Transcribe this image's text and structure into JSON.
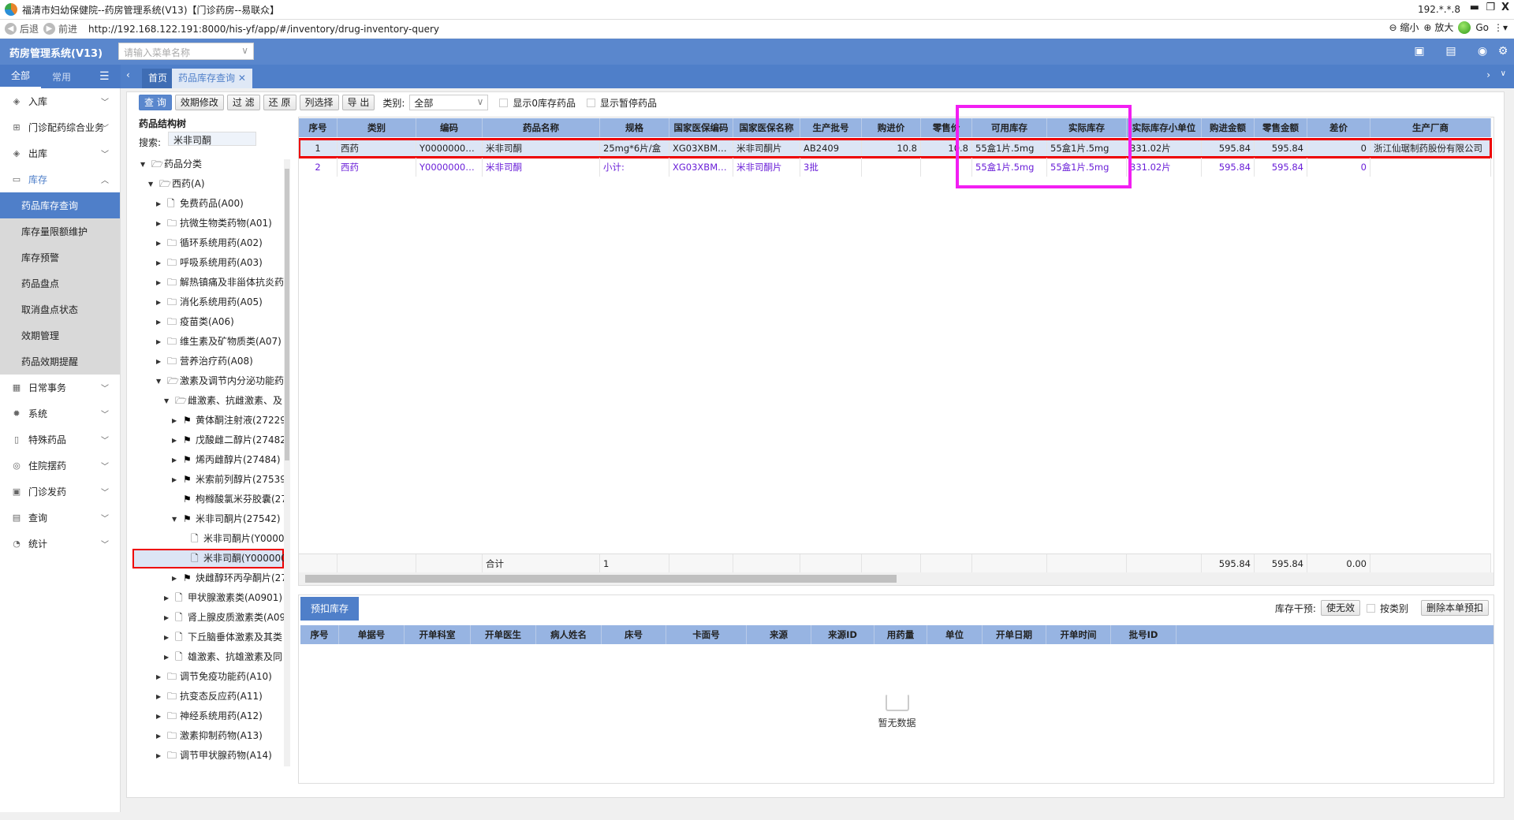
{
  "window": {
    "title": "福清市妇幼保健院--药房管理系统(V13)【门诊药房--易联众】",
    "ip": "192.*.*.8",
    "min": "▬",
    "restore": "❐",
    "close": "X"
  },
  "browser": {
    "back": "后退",
    "forward": "前进",
    "url": "http://192.168.122.191:8000/his-yf/app/#/inventory/drug-inventory-query",
    "zoom_out": "缩小",
    "zoom_in": "放大",
    "go": "Go"
  },
  "app": {
    "title": "药房管理系统(V13)",
    "menu_search_placeholder": "请输入菜单名称"
  },
  "sidetabs": [
    "全部",
    "常用"
  ],
  "tabs": [
    {
      "label": "首页"
    },
    {
      "label": "药品库存查询"
    }
  ],
  "sidebar": [
    {
      "label": "入库",
      "icon": "box-icon",
      "type": "group"
    },
    {
      "label": "门诊配药综合业务",
      "icon": "medkit-icon",
      "type": "group"
    },
    {
      "label": "出库",
      "icon": "box-out-icon",
      "type": "group"
    },
    {
      "label": "库存",
      "icon": "inventory-icon",
      "type": "open"
    },
    {
      "label": "药品库存查询",
      "type": "sel"
    },
    {
      "label": "库存量限额维护",
      "type": "sub"
    },
    {
      "label": "库存预警",
      "type": "sub"
    },
    {
      "label": "药品盘点",
      "type": "sub"
    },
    {
      "label": "取消盘点状态",
      "type": "sub"
    },
    {
      "label": "效期管理",
      "type": "sub"
    },
    {
      "label": "药品效期提醒",
      "type": "sub"
    },
    {
      "label": "日常事务",
      "icon": "calendar-icon",
      "type": "group"
    },
    {
      "label": "系统",
      "icon": "gear-icon",
      "type": "group"
    },
    {
      "label": "特殊药品",
      "icon": "bottle-icon",
      "type": "group"
    },
    {
      "label": "住院摆药",
      "icon": "pill-icon",
      "type": "group"
    },
    {
      "label": "门诊发药",
      "icon": "dispense-icon",
      "type": "group"
    },
    {
      "label": "查询",
      "icon": "query-icon",
      "type": "group"
    },
    {
      "label": "统计",
      "icon": "stats-icon",
      "type": "group"
    }
  ],
  "toolbar": {
    "query": "查 询",
    "expiry_edit": "效期修改",
    "filter": "过 滤",
    "reset": "还 原",
    "columns": "列选择",
    "export": "导 出",
    "category_label": "类别:",
    "category_value": "全部",
    "show_zero": "显示0库存药品",
    "show_paused": "显示暂停药品"
  },
  "tree": {
    "title": "药品结构树",
    "search_label": "搜索:",
    "search_value": "米非司酮",
    "items": [
      {
        "l": 0,
        "t": "药品分类",
        "i": "open",
        "a": "down"
      },
      {
        "l": 1,
        "t": "西药(A)",
        "i": "open",
        "a": "down"
      },
      {
        "l": 2,
        "t": "免费药品(A00)",
        "i": "file",
        "a": "right"
      },
      {
        "l": 2,
        "t": "抗微生物类药物(A01)",
        "i": "folder",
        "a": "right"
      },
      {
        "l": 2,
        "t": "循环系统用药(A02)",
        "i": "folder",
        "a": "right"
      },
      {
        "l": 2,
        "t": "呼吸系统用药(A03)",
        "i": "folder",
        "a": "right"
      },
      {
        "l": 2,
        "t": "解热镇痛及非甾体抗炎药",
        "i": "folder",
        "a": "right"
      },
      {
        "l": 2,
        "t": "消化系统用药(A05)",
        "i": "folder",
        "a": "right"
      },
      {
        "l": 2,
        "t": "疫苗类(A06)",
        "i": "folder",
        "a": "right"
      },
      {
        "l": 2,
        "t": "维生素及矿物质类(A07)",
        "i": "folder",
        "a": "right"
      },
      {
        "l": 2,
        "t": "营养治疗药(A08)",
        "i": "folder",
        "a": "right"
      },
      {
        "l": 2,
        "t": "激素及调节内分泌功能药",
        "i": "open",
        "a": "down"
      },
      {
        "l": 3,
        "t": "雌激素、抗雌激素、及",
        "i": "open",
        "a": "down"
      },
      {
        "l": 4,
        "t": "黄体酮注射液(27229)",
        "i": "flag",
        "a": "right"
      },
      {
        "l": 4,
        "t": "戊酸雌二醇片(27482)",
        "i": "flag",
        "a": "right"
      },
      {
        "l": 4,
        "t": "烯丙雌醇片(27484)",
        "i": "flag",
        "a": "right"
      },
      {
        "l": 4,
        "t": "米索前列醇片(27539)",
        "i": "flag",
        "a": "right"
      },
      {
        "l": 4,
        "t": "枸橼酸氯米芬胶囊(27",
        "i": "flag",
        "a": ""
      },
      {
        "l": 4,
        "t": "米非司酮片(27542)",
        "i": "flag",
        "a": "down"
      },
      {
        "l": 5,
        "t": "米非司酮片(Y00000...",
        "i": "file",
        "a": ""
      },
      {
        "l": 5,
        "t": "米非司酮(Y0000000",
        "i": "file",
        "a": "",
        "sel": true
      },
      {
        "l": 4,
        "t": "炔雌醇环丙孕酮片(27",
        "i": "flag",
        "a": "right"
      },
      {
        "l": 3,
        "t": "甲状腺激素类(A0901)",
        "i": "file",
        "a": "right"
      },
      {
        "l": 3,
        "t": "肾上腺皮质激素类(A09",
        "i": "file",
        "a": "right"
      },
      {
        "l": 3,
        "t": "下丘脑垂体激素及其类",
        "i": "file",
        "a": "right"
      },
      {
        "l": 3,
        "t": "雄激素、抗雄激素及同",
        "i": "file",
        "a": "right"
      },
      {
        "l": 2,
        "t": "调节免疫功能药(A10)",
        "i": "folder",
        "a": "right"
      },
      {
        "l": 2,
        "t": "抗变态反应药(A11)",
        "i": "folder",
        "a": "right"
      },
      {
        "l": 2,
        "t": "神经系统用药(A12)",
        "i": "folder",
        "a": "right"
      },
      {
        "l": 2,
        "t": "激素抑制药物(A13)",
        "i": "folder",
        "a": "right"
      },
      {
        "l": 2,
        "t": "调节甲状腺药物(A14)",
        "i": "folder",
        "a": "right"
      }
    ]
  },
  "grid": {
    "columns": [
      "序号",
      "类别",
      "编码",
      "药品名称",
      "规格",
      "国家医保编码",
      "国家医保名称",
      "生产批号",
      "购进价",
      "零售价",
      "可用库存",
      "实际库存",
      "实际库存小单位",
      "购进金额",
      "零售金额",
      "差价",
      "生产厂商"
    ],
    "rows": [
      [
        "1",
        "西药",
        "Y000000023...",
        "米非司酮",
        "25mg*6片/盒",
        "XG03XBM09...",
        "米非司酮片",
        "AB2409",
        "10.8",
        "10.8",
        "55盒1片.5mg",
        "55盒1片.5mg",
        "331.02片",
        "595.84",
        "595.84",
        "0",
        "浙江仙琚制药股份有限公司"
      ],
      [
        "2",
        "西药",
        "Y000000023...",
        "米非司酮",
        "小计:",
        "XG03XBM09...",
        "米非司酮片",
        "3批",
        "",
        "",
        "55盒1片.5mg",
        "55盒1片.5mg",
        "331.02片",
        "595.84",
        "595.84",
        "0",
        ""
      ]
    ],
    "total": [
      "",
      "",
      "",
      "合计",
      "1",
      "",
      "",
      "",
      "",
      "",
      "",
      "",
      "",
      "595.84",
      "595.84",
      "0.00",
      ""
    ]
  },
  "bottom": {
    "tab": "预扣库存",
    "intervene_label": "库存干预:",
    "invalidate": "使无效",
    "by_category": "按类别",
    "delete_btn": "删除本单预扣",
    "columns": [
      "序号",
      "单据号",
      "开单科室",
      "开单医生",
      "病人姓名",
      "床号",
      "卡面号",
      "来源",
      "来源ID",
      "用药量",
      "单位",
      "开单日期",
      "开单时间",
      "批号ID"
    ],
    "empty": "暂无数据"
  },
  "colors": {
    "header": "#5a87cd",
    "tabbar": "#4f7fc9",
    "grid_header": "#97b4e2",
    "highlight_box": "#f21ef2",
    "selected_row_border": "#e00000",
    "subtotal_text": "#6a1fd8"
  }
}
